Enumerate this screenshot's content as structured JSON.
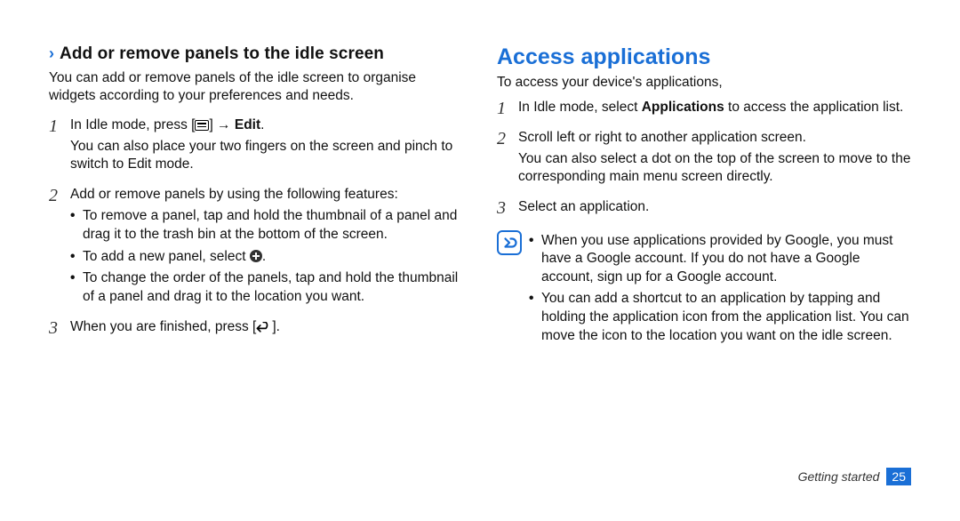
{
  "left": {
    "subhead": "Add or remove panels to the idle screen",
    "intro": "You can add or remove panels of the idle screen to organise widgets according to your preferences and needs.",
    "steps": [
      {
        "num": "1",
        "line1a": "In Idle mode, press [",
        "line1b": "] → ",
        "bold": "Edit",
        "line1c": ".",
        "line2": "You can also place your two fingers on the screen and pinch to switch to Edit mode."
      },
      {
        "num": "2",
        "line1": "Add or remove panels by using the following features:",
        "bullets": [
          {
            "text": "To remove a panel, tap and hold the thumbnail of a panel and drag it to the trash bin at the bottom of the screen."
          },
          {
            "pre": "To add a new panel, select ",
            "post": "."
          },
          {
            "text": "To change the order of the panels, tap and hold the thumbnail of a panel and drag it to the location you want."
          }
        ]
      },
      {
        "num": "3",
        "line1a": "When you are finished, press [",
        "line1b": "]."
      }
    ]
  },
  "right": {
    "title": "Access applications",
    "intro": "To access your device's applications,",
    "steps": [
      {
        "num": "1",
        "pre": "In Idle mode, select ",
        "bold": "Applications",
        "post": " to access the application list."
      },
      {
        "num": "2",
        "line1": "Scroll left or right to another application screen.",
        "line2": "You can also select a dot on the top of the screen to move to the corresponding main menu screen directly."
      },
      {
        "num": "3",
        "line1": "Select an application."
      }
    ],
    "note_bullets": [
      "When you use applications provided by Google, you must have a Google account. If you do not have a Google account, sign up for a Google account.",
      "You can add a shortcut to an application by tapping and holding the application icon from the application list. You can move the icon to the location you want on the idle screen."
    ]
  },
  "footer": {
    "section": "Getting started",
    "page": "25"
  }
}
